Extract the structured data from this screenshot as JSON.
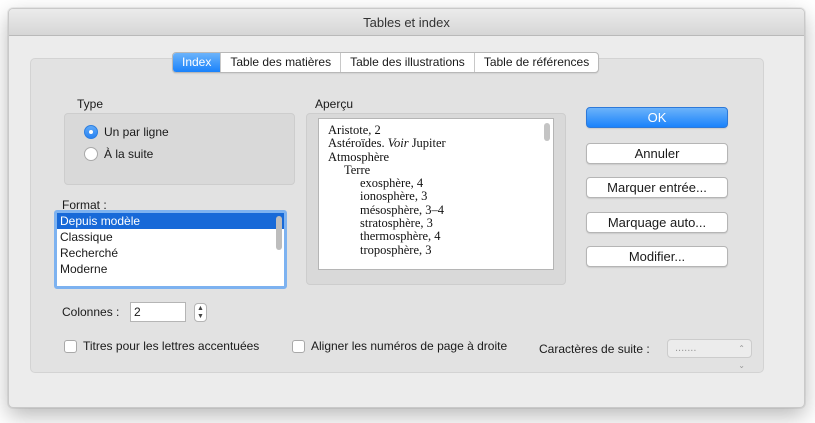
{
  "window": {
    "title": "Tables et index"
  },
  "tabs": [
    {
      "label": "Index",
      "active": true
    },
    {
      "label": "Table des matières",
      "active": false
    },
    {
      "label": "Table des illustrations",
      "active": false
    },
    {
      "label": "Table de références",
      "active": false
    }
  ],
  "type_section": {
    "label": "Type",
    "options": [
      {
        "label": "Un par ligne",
        "checked": true
      },
      {
        "label": "À la suite",
        "checked": false
      }
    ]
  },
  "format_section": {
    "label": "Format :",
    "items": [
      "Depuis modèle",
      "Classique",
      "Recherché",
      "Moderne"
    ],
    "selected": "Depuis modèle"
  },
  "preview_section": {
    "label": "Aperçu",
    "lines": [
      {
        "text": "Aristote, 2",
        "indent": 0
      },
      {
        "text": "Astéroïdes. ",
        "italic": "Voir",
        "after": " Jupiter",
        "indent": 0
      },
      {
        "text": "Atmosphère",
        "indent": 0
      },
      {
        "text": "Terre",
        "indent": 1
      },
      {
        "text": "exosphère, 4",
        "indent": 2
      },
      {
        "text": "ionosphère, 3",
        "indent": 2
      },
      {
        "text": "mésosphère, 3–4",
        "indent": 2
      },
      {
        "text": "stratosphère, 3",
        "indent": 2
      },
      {
        "text": "thermosphère, 4",
        "indent": 2
      },
      {
        "text": "troposphère, 3",
        "indent": 2
      }
    ]
  },
  "buttons": {
    "ok": "OK",
    "cancel": "Annuler",
    "mark_entry": "Marquer entrée...",
    "auto_mark": "Marquage auto...",
    "modify": "Modifier..."
  },
  "columns": {
    "label": "Colonnes :",
    "value": "2"
  },
  "options": {
    "accent_titles": {
      "label": "Titres pour les lettres accentuées",
      "checked": false
    },
    "right_align": {
      "label": "Aligner les numéros de page à droite",
      "checked": false
    }
  },
  "leader": {
    "label": "Caractères de suite :",
    "value": "......."
  },
  "colors": {
    "accent": "#1a82fb",
    "selection": "#1769d8"
  }
}
